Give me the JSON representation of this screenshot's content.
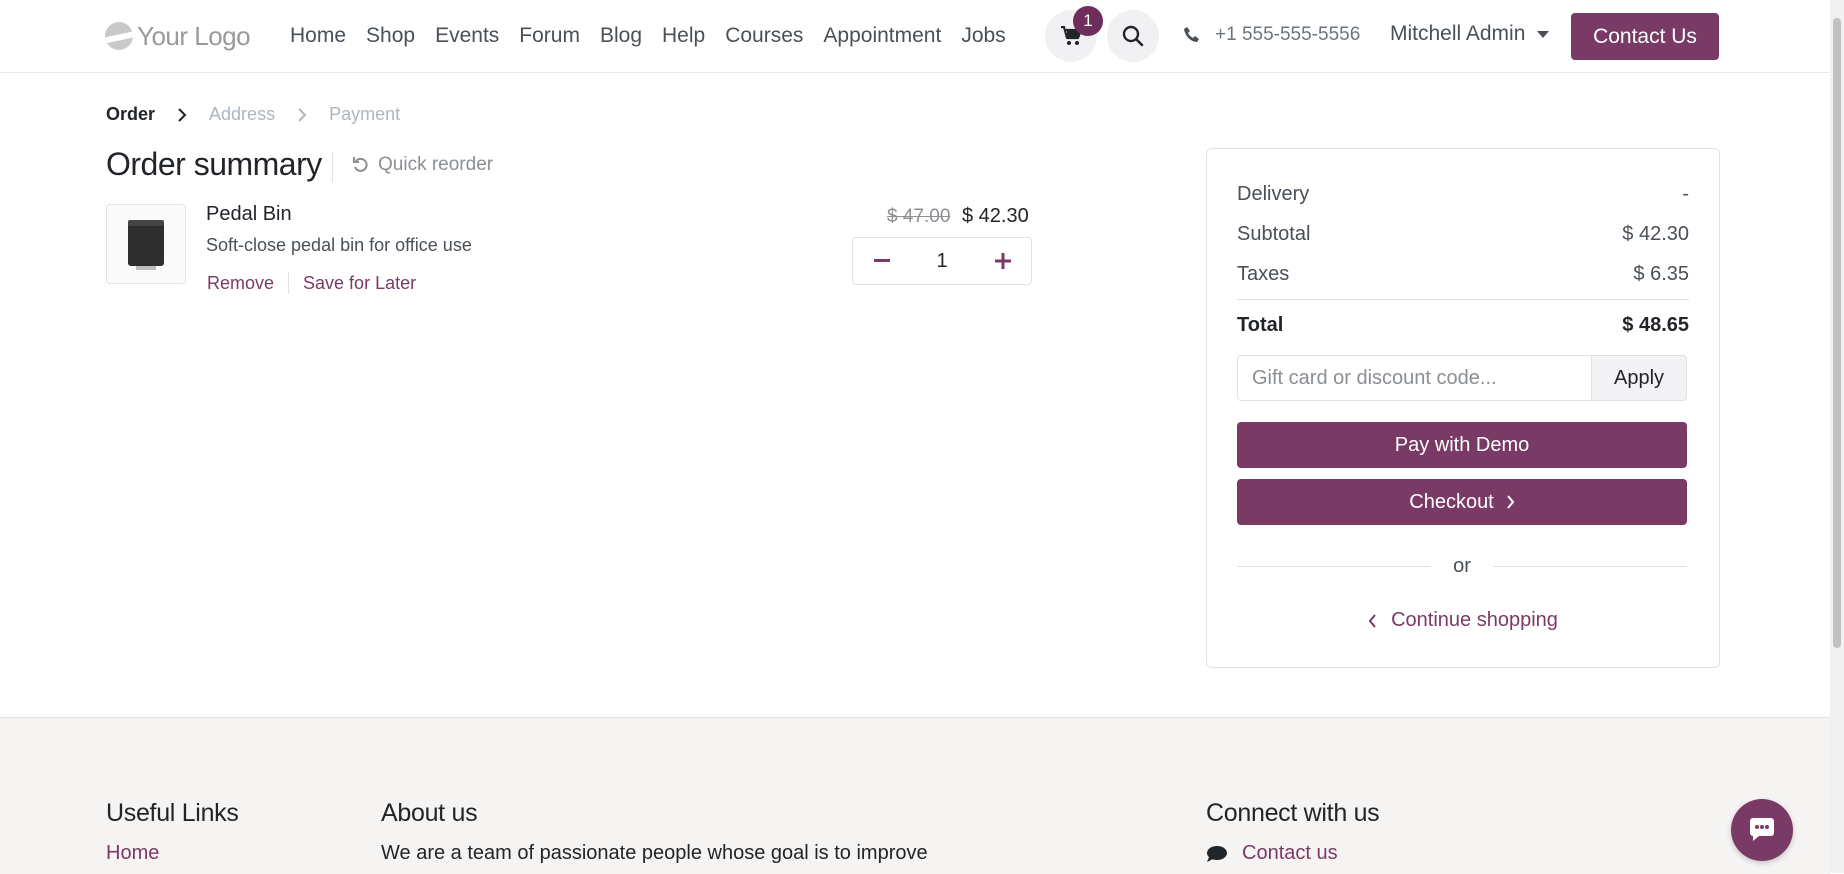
{
  "header": {
    "logo_text": "Your Logo",
    "nav": [
      "Home",
      "Shop",
      "Events",
      "Forum",
      "Blog",
      "Help",
      "Courses",
      "Appointment",
      "Jobs"
    ],
    "cart_count": "1",
    "phone": "+1 555-555-5556",
    "user_name": "Mitchell Admin",
    "contact_label": "Contact Us"
  },
  "breadcrumb": {
    "step1": "Order",
    "step2": "Address",
    "step3": "Payment"
  },
  "order": {
    "title": "Order summary",
    "quick_reorder": "Quick reorder",
    "product": {
      "name": "Pedal Bin",
      "description": "Soft-close pedal bin for office use",
      "remove": "Remove",
      "save_later": "Save for Later",
      "old_price": "$ 47.00",
      "price": "$ 42.30",
      "quantity": "1"
    }
  },
  "summary": {
    "delivery_label": "Delivery",
    "delivery_value": "-",
    "subtotal_label": "Subtotal",
    "subtotal_value": "$ 42.30",
    "taxes_label": "Taxes",
    "taxes_value": "$ 6.35",
    "total_label": "Total",
    "total_value": "$ 48.65",
    "coupon_placeholder": "Gift card or discount code...",
    "apply_label": "Apply",
    "pay_demo_label": "Pay with Demo",
    "checkout_label": "Checkout",
    "or_label": "or",
    "continue_label": "Continue shopping"
  },
  "footer": {
    "useful_links": "Useful Links",
    "home_link": "Home",
    "about_heading": "About us",
    "about_text": "We are a team of passionate people whose goal is to improve",
    "connect_heading": "Connect with us",
    "contact_link": "Contact us"
  },
  "colors": {
    "brand": "#7a3a66",
    "badge": "#6f2d5c"
  }
}
